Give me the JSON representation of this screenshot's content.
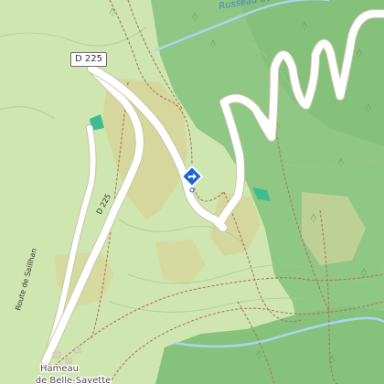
{
  "map": {
    "colors": {
      "meadow": "#cfe6b0",
      "forest": "#8fc784",
      "forest_dark": "#77b86e",
      "scrub": "#d6d49a",
      "road_fill": "#ffffff",
      "road_casing": "#c9c6a6",
      "water": "#a9d6ef",
      "path": "#b2755a",
      "contour": "#9dbf84",
      "pond": "#3fbd8f",
      "marker": "#1e64d8"
    },
    "road_badge": {
      "label": "D 225"
    },
    "labels": {
      "stream": "Russeau de la Mède",
      "road_d225": "D 225",
      "route_saillan": "Route de Saillhan",
      "hamlet_line1": "Hameau",
      "hamlet_line2": "de Belle-Savette"
    },
    "marker": {
      "icon": "directions-diamond-icon"
    }
  }
}
